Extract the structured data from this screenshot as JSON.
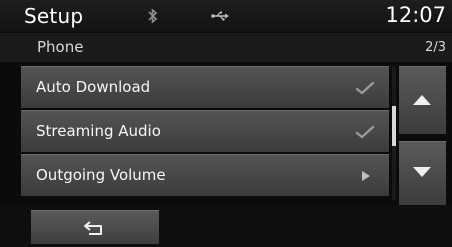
{
  "status_bar": {
    "title": "Setup",
    "bluetooth_icon": "bluetooth-icon",
    "usb_icon": "usb-icon",
    "time": "12:07"
  },
  "sub_header": {
    "category": "Phone",
    "page": "2/3"
  },
  "menu": {
    "items": [
      {
        "label": "Auto Download",
        "indicator": "check-icon",
        "checked": true
      },
      {
        "label": "Streaming Audio",
        "indicator": "check-icon",
        "checked": true
      },
      {
        "label": "Outgoing Volume",
        "indicator": "arrow-right-icon"
      }
    ]
  },
  "scroll": {
    "up_icon": "arrow-up-icon",
    "down_icon": "arrow-down-icon"
  },
  "bottom_bar": {
    "back_icon": "back-icon"
  },
  "colors": {
    "background": "#0b0b0b",
    "item": "#484848",
    "text": "#f2f2f2",
    "icon": "#9a9a9a"
  }
}
